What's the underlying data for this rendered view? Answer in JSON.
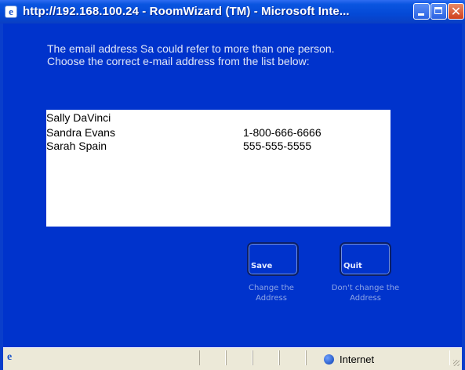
{
  "window": {
    "title": "http://192.168.100.24 - RoomWizard (TM) - Microsoft Inte...",
    "controls": {
      "minimize_icon": "minimize-icon",
      "maximize_icon": "maximize-icon",
      "close_icon": "close-icon",
      "close_glyph": "✕"
    }
  },
  "prompt": {
    "line1": "The email address Sa could refer to more than one person.",
    "line2": "Choose the correct e-mail address from the list below:"
  },
  "list": {
    "items": [
      {
        "name": "Sally DaVinci",
        "phone": ""
      },
      {
        "name": "Sandra Evans",
        "phone": "1-800-666-6666"
      },
      {
        "name": "Sarah Spain",
        "phone": "555-555-5555"
      }
    ]
  },
  "actions": {
    "save": {
      "label": "Save",
      "caption_line1": "Change the",
      "caption_line2": "Address"
    },
    "quit": {
      "label": "Quit",
      "caption_line1": "Don't change the",
      "caption_line2": "Address"
    }
  },
  "statusbar": {
    "zone": "Internet",
    "zone_icon": "globe-icon",
    "page_icon": "ie-page-icon"
  },
  "colors": {
    "content_bg": "#0033cc",
    "list_bg": "#ffffff",
    "statusbar_bg": "#ece9d8"
  }
}
